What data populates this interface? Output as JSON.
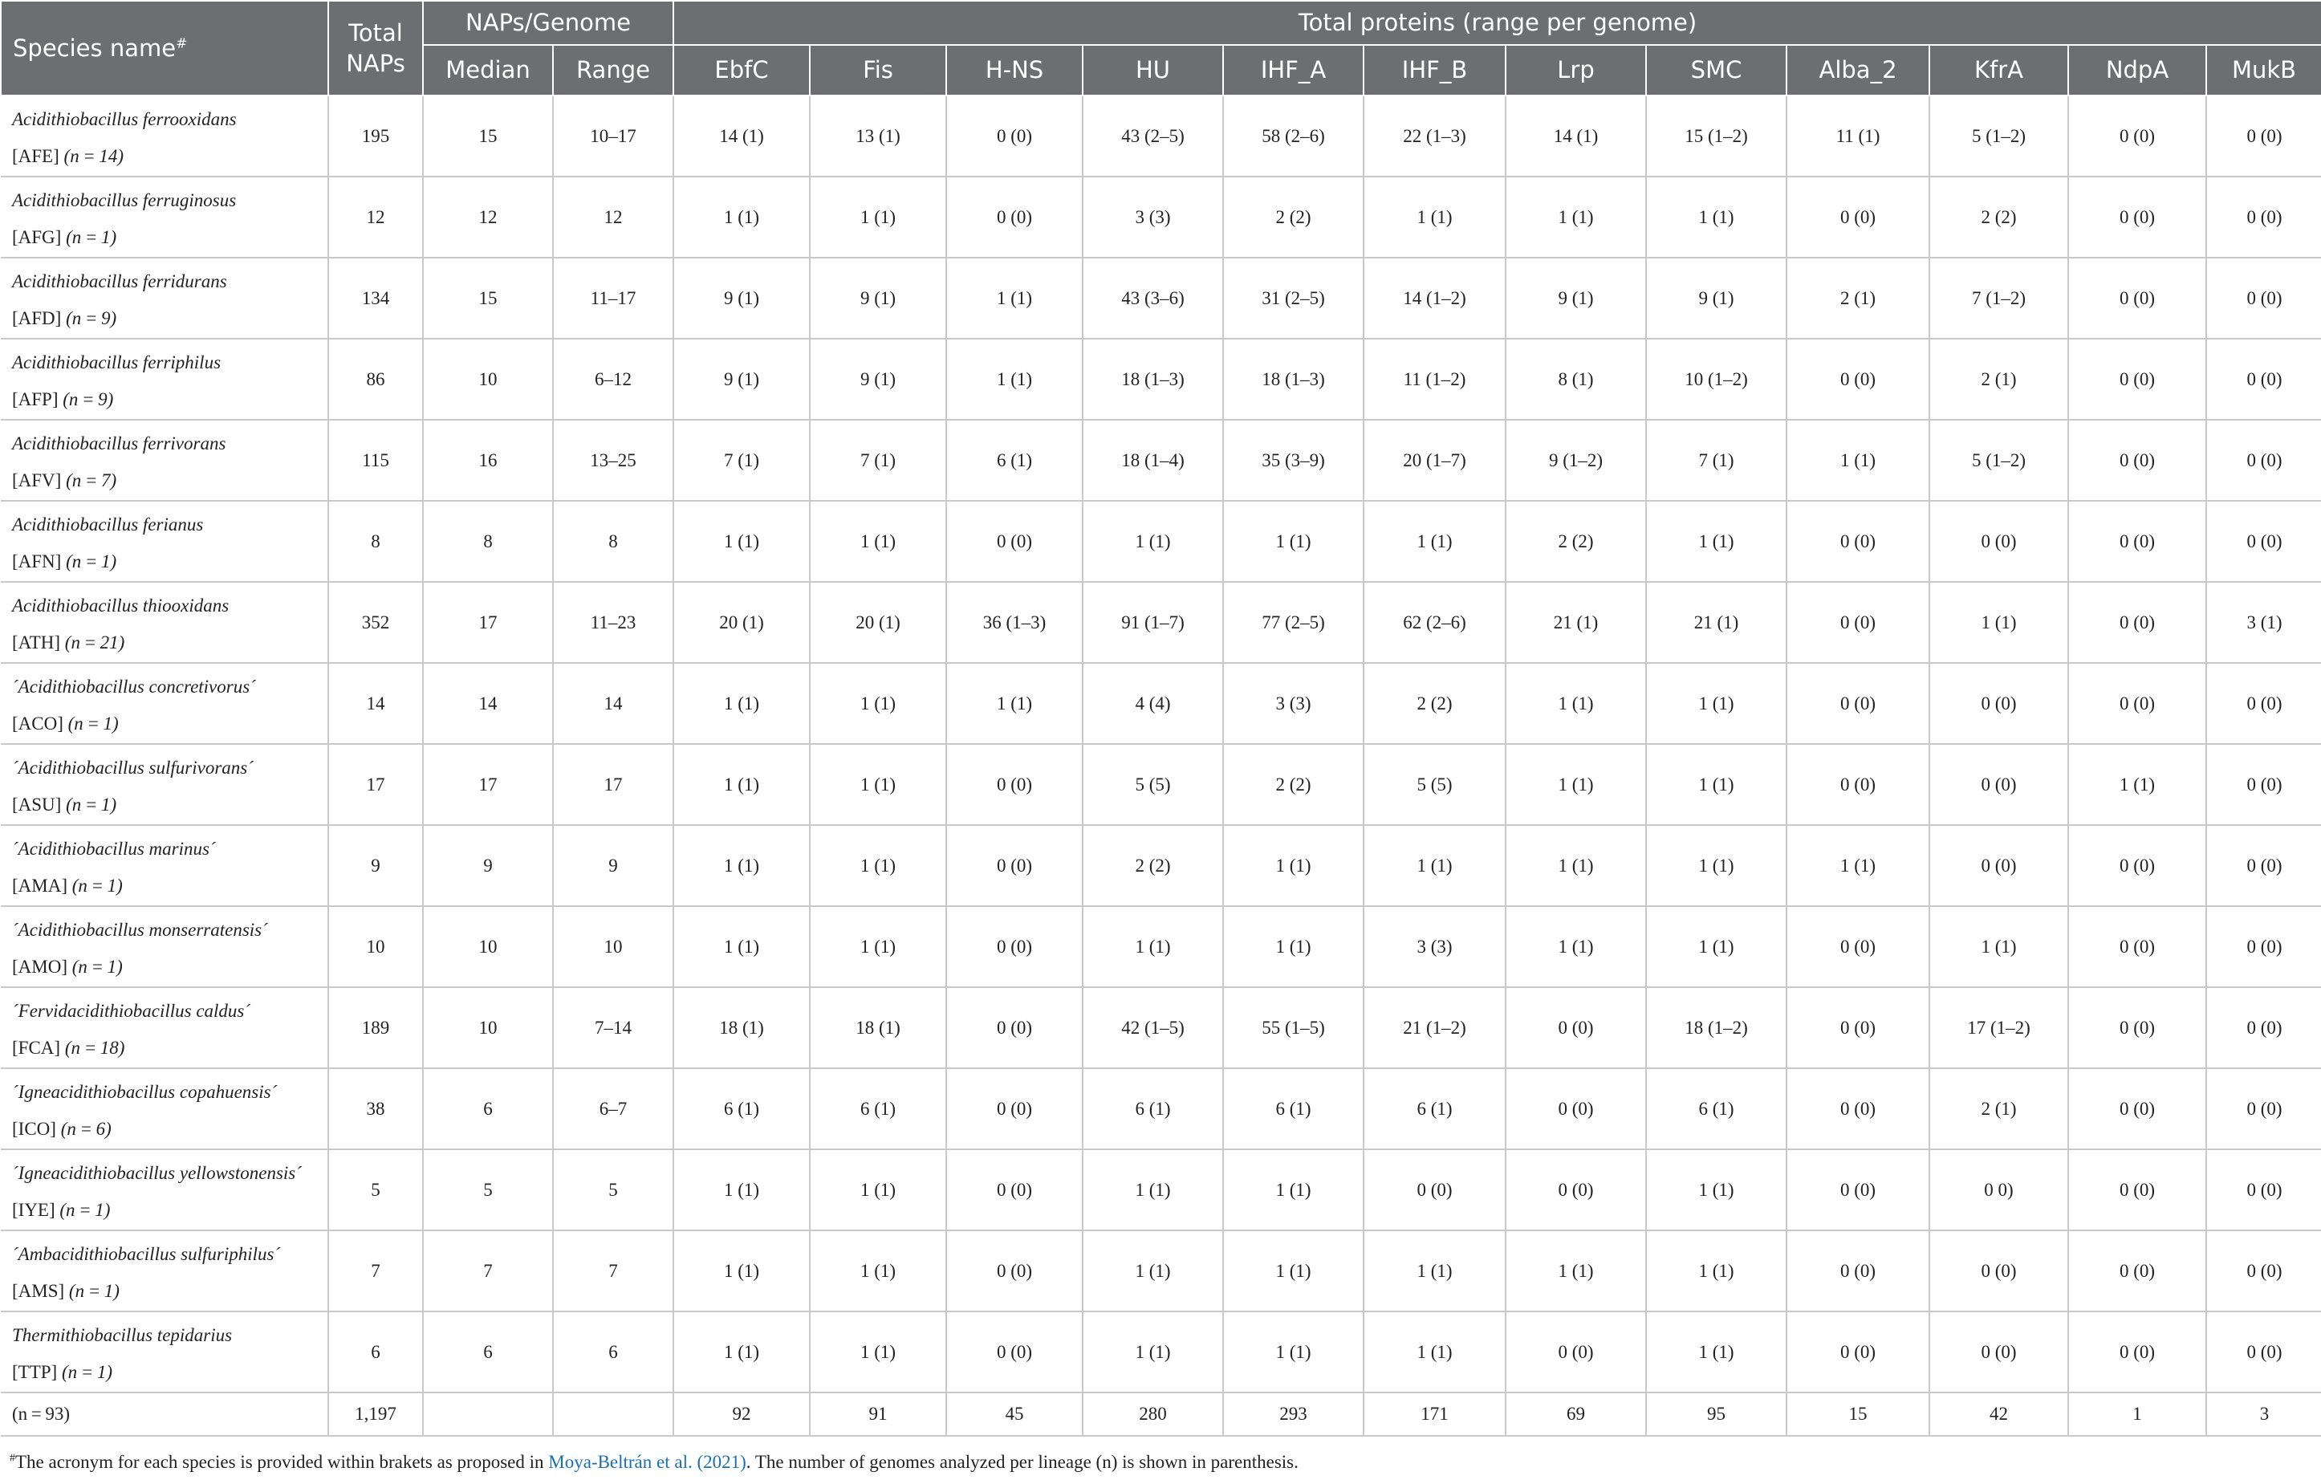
{
  "header": {
    "species_name": "Species name",
    "species_mark": "#",
    "total_naps_line1": "Total",
    "total_naps_line2": "NAPs",
    "naps_genome": "NAPs/Genome",
    "median": "Median",
    "range": "Range",
    "total_proteins": "Total proteins (range per genome)",
    "proteins": [
      "EbfC",
      "Fis",
      "H-NS",
      "HU",
      "IHF_A",
      "IHF_B",
      "Lrp",
      "SMC",
      "Alba_2",
      "KfrA",
      "NdpA",
      "MukB"
    ]
  },
  "rows": [
    {
      "name": "Acidithiobacillus ferrooxidans",
      "acronym": "[AFE]",
      "n": "(n = 14)",
      "total": "195",
      "median": "15",
      "range": "10–17",
      "values": [
        "14 (1)",
        "13 (1)",
        "0 (0)",
        "43 (2–5)",
        "58 (2–6)",
        "22 (1–3)",
        "14 (1)",
        "15 (1–2)",
        "11 (1)",
        "5 (1–2)",
        "0 (0)",
        "0 (0)"
      ]
    },
    {
      "name": "Acidithiobacillus ferruginosus",
      "acronym": "[AFG]",
      "n": "(n = 1)",
      "total": "12",
      "median": "12",
      "range": "12",
      "values": [
        "1 (1)",
        "1 (1)",
        "0 (0)",
        "3 (3)",
        "2 (2)",
        "1 (1)",
        "1 (1)",
        "1 (1)",
        "0 (0)",
        "2 (2)",
        "0 (0)",
        "0 (0)"
      ]
    },
    {
      "name": "Acidithiobacillus ferridurans",
      "acronym": "[AFD]",
      "n": "(n = 9)",
      "total": "134",
      "median": "15",
      "range": "11–17",
      "values": [
        "9 (1)",
        "9 (1)",
        "1 (1)",
        "43 (3–6)",
        "31 (2–5)",
        "14 (1–2)",
        "9 (1)",
        "9 (1)",
        "2 (1)",
        "7 (1–2)",
        "0 (0)",
        "0 (0)"
      ]
    },
    {
      "name": "Acidithiobacillus ferriphilus",
      "acronym": "[AFP]",
      "n": "(n = 9)",
      "total": "86",
      "median": "10",
      "range": "6–12",
      "values": [
        "9 (1)",
        "9 (1)",
        "1 (1)",
        "18 (1–3)",
        "18 (1–3)",
        "11 (1–2)",
        "8 (1)",
        "10 (1–2)",
        "0 (0)",
        "2 (1)",
        "0 (0)",
        "0 (0)"
      ]
    },
    {
      "name": "Acidithiobacillus ferrivorans",
      "acronym": "[AFV]",
      "n": "(n = 7)",
      "total": "115",
      "median": "16",
      "range": "13–25",
      "values": [
        "7 (1)",
        "7 (1)",
        "6 (1)",
        "18 (1–4)",
        "35 (3–9)",
        "20 (1–7)",
        "9 (1–2)",
        "7 (1)",
        "1 (1)",
        "5 (1–2)",
        "0 (0)",
        "0 (0)"
      ]
    },
    {
      "name": "Acidithiobacillus ferianus",
      "acronym": "[AFN]",
      "n": "(n = 1)",
      "total": "8",
      "median": "8",
      "range": "8",
      "values": [
        "1 (1)",
        "1 (1)",
        "0 (0)",
        "1 (1)",
        "1 (1)",
        "1 (1)",
        "2 (2)",
        "1 (1)",
        "0 (0)",
        "0 (0)",
        "0 (0)",
        "0 (0)"
      ]
    },
    {
      "name": "Acidithiobacillus thiooxidans",
      "acronym": "[ATH]",
      "n": "(n = 21)",
      "total": "352",
      "median": "17",
      "range": "11–23",
      "values": [
        "20 (1)",
        "20 (1)",
        "36 (1–3)",
        "91 (1–7)",
        "77 (2–5)",
        "62 (2–6)",
        "21 (1)",
        "21 (1)",
        "0 (0)",
        "1 (1)",
        "0 (0)",
        "3 (1)"
      ]
    },
    {
      "name": "´Acidithiobacillus concretivorus´",
      "acronym": "[ACO]",
      "n": "(n = 1)",
      "total": "14",
      "median": "14",
      "range": "14",
      "values": [
        "1 (1)",
        "1 (1)",
        "1 (1)",
        "4 (4)",
        "3 (3)",
        "2 (2)",
        "1 (1)",
        "1 (1)",
        "0 (0)",
        "0 (0)",
        "0 (0)",
        "0 (0)"
      ]
    },
    {
      "name": "´Acidithiobacillus sulfurivorans´",
      "acronym": "[ASU]",
      "n": "(n = 1)",
      "total": "17",
      "median": "17",
      "range": "17",
      "values": [
        "1 (1)",
        "1 (1)",
        "0 (0)",
        "5 (5)",
        "2 (2)",
        "5 (5)",
        "1 (1)",
        "1 (1)",
        "0 (0)",
        "0 (0)",
        "1 (1)",
        "0 (0)"
      ]
    },
    {
      "name": "´Acidithiobacillus marinus´",
      "acronym": "[AMA]",
      "n": "(n = 1)",
      "total": "9",
      "median": "9",
      "range": "9",
      "values": [
        "1 (1)",
        "1 (1)",
        "0 (0)",
        "2 (2)",
        "1 (1)",
        "1 (1)",
        "1 (1)",
        "1 (1)",
        "1 (1)",
        "0 (0)",
        "0 (0)",
        "0 (0)"
      ]
    },
    {
      "name": "´Acidithiobacillus monserratensis´",
      "acronym": "[AMO]",
      "n": "(n = 1)",
      "total": "10",
      "median": "10",
      "range": "10",
      "values": [
        "1 (1)",
        "1 (1)",
        "0 (0)",
        "1 (1)",
        "1 (1)",
        "3 (3)",
        "1 (1)",
        "1 (1)",
        "0 (0)",
        "1 (1)",
        "0 (0)",
        "0 (0)"
      ]
    },
    {
      "name": "´Fervidacidithiobacillus caldus´",
      "acronym": "[FCA]",
      "n": "(n = 18)",
      "total": "189",
      "median": "10",
      "range": "7–14",
      "values": [
        "18 (1)",
        "18 (1)",
        "0 (0)",
        "42 (1–5)",
        "55 (1–5)",
        "21 (1–2)",
        "0 (0)",
        "18 (1–2)",
        "0 (0)",
        "17 (1–2)",
        "0 (0)",
        "0 (0)"
      ]
    },
    {
      "name": "´Igneacidithiobacillus copahuensis´",
      "acronym": "[ICO]",
      "n": "(n = 6)",
      "total": "38",
      "median": "6",
      "range": "6–7",
      "values": [
        "6 (1)",
        "6 (1)",
        "0 (0)",
        "6 (1)",
        "6 (1)",
        "6 (1)",
        "0 (0)",
        "6 (1)",
        "0 (0)",
        "2 (1)",
        "0 (0)",
        "0 (0)"
      ]
    },
    {
      "name": "´Igneacidithiobacillus yellowstonensis´",
      "acronym": "[IYE]",
      "n": "(n = 1)",
      "total": "5",
      "median": "5",
      "range": "5",
      "values": [
        "1 (1)",
        "1 (1)",
        "0 (0)",
        "1 (1)",
        "1 (1)",
        "0 (0)",
        "0 (0)",
        "1 (1)",
        "0 (0)",
        "0 0)",
        "0 (0)",
        "0 (0)"
      ]
    },
    {
      "name": "´Ambacidithiobacillus sulfuriphilus´",
      "acronym": "[AMS]",
      "n": "(n = 1)",
      "total": "7",
      "median": "7",
      "range": "7",
      "values": [
        "1 (1)",
        "1 (1)",
        "0 (0)",
        "1 (1)",
        "1 (1)",
        "1 (1)",
        "1 (1)",
        "1 (1)",
        "0 (0)",
        "0 (0)",
        "0 (0)",
        "0 (0)"
      ]
    },
    {
      "name": "Thermithiobacillus tepidarius",
      "acronym": "[TTP]",
      "n": "(n = 1)",
      "total": "6",
      "median": "6",
      "range": "6",
      "values": [
        "1 (1)",
        "1 (1)",
        "0 (0)",
        "1 (1)",
        "1 (1)",
        "1 (1)",
        "0 (0)",
        "1 (1)",
        "0 (0)",
        "0 (0)",
        "0 (0)",
        "0 (0)"
      ]
    }
  ],
  "totals": {
    "label": "(n = 93)",
    "total": "1,197",
    "median": "",
    "range": "",
    "values": [
      "92",
      "91",
      "45",
      "280",
      "293",
      "171",
      "69",
      "95",
      "15",
      "42",
      "1",
      "3"
    ]
  },
  "footnote": {
    "mark": "#",
    "text_before": "The acronym for each species is provided within brakets as proposed in ",
    "reference": "Moya-Beltrán et al. (2021)",
    "text_after": ". The number of genomes analyzed per lineage (n) is shown in parenthesis."
  },
  "colors": {
    "header_bg": "#6d6e71",
    "reference_link": "#1a6fb5"
  }
}
